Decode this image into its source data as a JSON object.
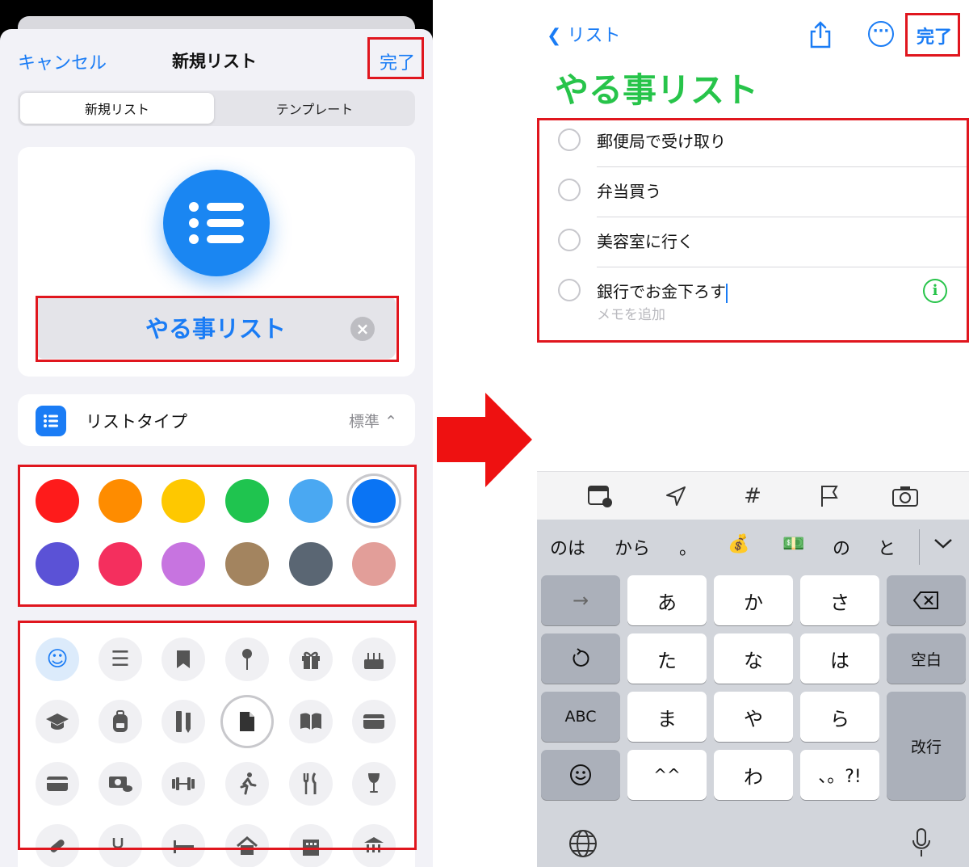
{
  "left_panel": {
    "cancel_label": "キャンセル",
    "title": "新規リスト",
    "done_label": "完了",
    "segments": [
      "新規リスト",
      "テンプレート"
    ],
    "list_name": "やる事リスト",
    "list_type_label": "リストタイプ",
    "list_type_value": "標準",
    "colors": [
      "#fe1b1b",
      "#fe8c00",
      "#fec800",
      "#1fc44f",
      "#4aa8f2",
      "#0a74f4",
      "#5b52d6",
      "#f42f5e",
      "#c774e0",
      "#a3845f",
      "#5a6673",
      "#e29e99"
    ],
    "selected_color": "#0a74f4",
    "icon_names": [
      "smiley-icon",
      "list-icon",
      "bookmark-icon",
      "pin-icon",
      "gift-icon",
      "cake-icon",
      "graduation-cap-icon",
      "backpack-icon",
      "ruler-pencil-icon",
      "document-icon",
      "book-icon",
      "wallet-icon",
      "credit-card-icon",
      "money-icon",
      "dumbbell-icon",
      "running-icon",
      "fork-knife-icon",
      "wine-glass-icon"
    ]
  },
  "right_panel": {
    "back_label": "リスト",
    "done_label": "完了",
    "list_title": "やる事リスト",
    "title_color": "#27c44a",
    "tasks": [
      "郵便局で受け取り",
      "弁当買う",
      "美容室に行く",
      "銀行でお金下ろす"
    ],
    "note_placeholder": "メモを追加"
  },
  "keyboard": {
    "suggestions": [
      "のは",
      "から",
      "。",
      "💰",
      "💵",
      "の",
      "と"
    ],
    "row1": [
      "→",
      "あ",
      "か",
      "さ"
    ],
    "row2": [
      "た",
      "な",
      "は",
      "空白"
    ],
    "row3": [
      "ABC",
      "ま",
      "や",
      "ら",
      "改行"
    ],
    "row4": [
      "^^",
      "わ",
      "、。?!"
    ]
  },
  "accent_color": "#1a7cf5",
  "highlight_color": "#e0161e"
}
